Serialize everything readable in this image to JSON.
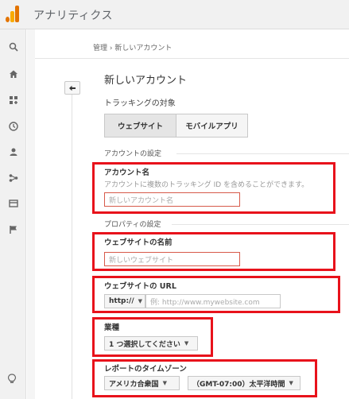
{
  "header": {
    "app_title": "アナリティクス"
  },
  "sidebar": {
    "icons": [
      "search-icon",
      "home-icon",
      "dashboard-icon",
      "clock-icon",
      "person-icon",
      "acquisition-icon",
      "display-icon",
      "flag-icon",
      "lightbulb-icon"
    ]
  },
  "breadcrumb": "管理 › 新しいアカウント",
  "main": {
    "title": "新しいアカウント",
    "tracking_label": "トラッキングの対象",
    "tabs": [
      {
        "label": "ウェブサイト",
        "active": true
      },
      {
        "label": "モバイルアプリ",
        "active": false
      }
    ],
    "account_section": "アカウントの設定",
    "account_name": {
      "label": "アカウント名",
      "hint": "アカウントに複数のトラッキング ID を含めることができます。",
      "placeholder": "新しいアカウント名"
    },
    "property_section": "プロパティの設定",
    "website_name": {
      "label": "ウェブサイトの名前",
      "placeholder": "新しいウェブサイト"
    },
    "website_url": {
      "label": "ウェブサイトの URL",
      "protocol": "http://",
      "placeholder": "例: http://www.mywebsite.com"
    },
    "industry": {
      "label": "業種",
      "selected": "1 つ選択してください"
    },
    "timezone": {
      "label": "レポートのタイムゾーン",
      "country": "アメリカ合衆国",
      "zone": "（GMT-07:00）太平洋時間"
    }
  },
  "colors": {
    "highlight": "#e8121b",
    "input_error": "#d75a4a",
    "accent": "#e37400"
  }
}
